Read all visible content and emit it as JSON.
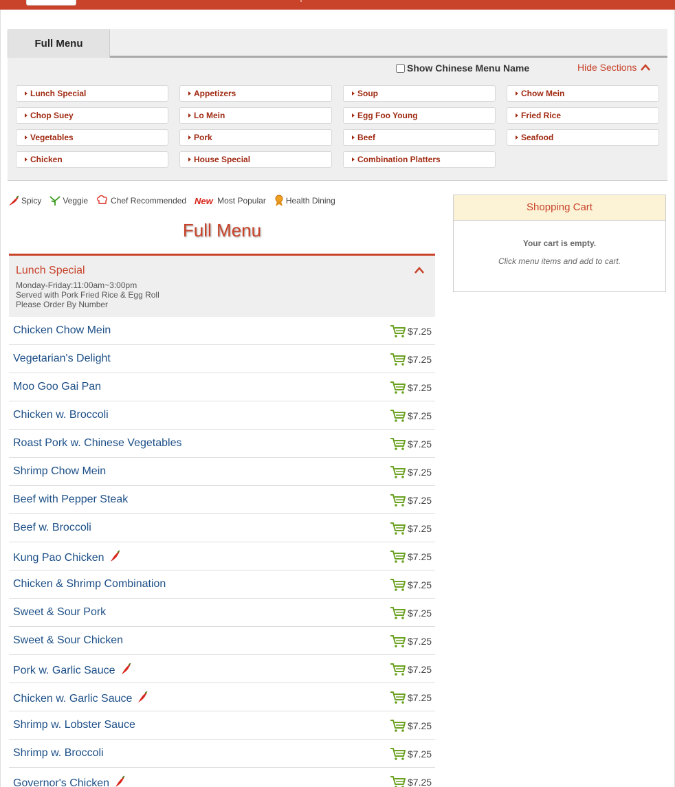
{
  "tabs": [
    {
      "label": "Full Menu",
      "active": true
    }
  ],
  "chinese_toggle": {
    "label": "Show Chinese Menu Name",
    "checked": false
  },
  "hide_sections_label": "Hide Sections",
  "sections": [
    "Lunch Special",
    "Appetizers",
    "Soup",
    "Chow Mein",
    "Chop Suey",
    "Lo Mein",
    "Egg Foo Young",
    "Fried Rice",
    "Vegetables",
    "Pork",
    "Beef",
    "Seafood",
    "Chicken",
    "House Special",
    "Combination Platters"
  ],
  "legend": {
    "spicy": "Spicy",
    "veggie": "Veggie",
    "chef": "Chef Recommended",
    "popular": "Most Popular",
    "new_badge": "New",
    "health": "Health Dining"
  },
  "menu_title": "Full Menu",
  "section": {
    "title": "Lunch Special",
    "desc1": "Monday-Friday:11:00am~3:00pm",
    "desc2": "Served with Pork Fried Rice & Egg Roll",
    "desc3": "Please Order By Number"
  },
  "items": [
    {
      "name": "Chicken Chow Mein",
      "price": "$7.25",
      "spicy": false
    },
    {
      "name": "Vegetarian's Delight",
      "price": "$7.25",
      "spicy": false
    },
    {
      "name": "Moo Goo Gai Pan",
      "price": "$7.25",
      "spicy": false
    },
    {
      "name": "Chicken w. Broccoli",
      "price": "$7.25",
      "spicy": false
    },
    {
      "name": "Roast Pork w. Chinese Vegetables",
      "price": "$7.25",
      "spicy": false
    },
    {
      "name": "Shrimp Chow Mein",
      "price": "$7.25",
      "spicy": false
    },
    {
      "name": "Beef with Pepper Steak",
      "price": "$7.25",
      "spicy": false
    },
    {
      "name": "Beef w. Broccoli",
      "price": "$7.25",
      "spicy": false
    },
    {
      "name": "Kung Pao Chicken",
      "price": "$7.25",
      "spicy": true
    },
    {
      "name": "Chicken & Shrimp Combination",
      "price": "$7.25",
      "spicy": false
    },
    {
      "name": "Sweet & Sour Pork",
      "price": "$7.25",
      "spicy": false
    },
    {
      "name": "Sweet & Sour Chicken",
      "price": "$7.25",
      "spicy": false
    },
    {
      "name": "Pork w. Garlic Sauce",
      "price": "$7.25",
      "spicy": true
    },
    {
      "name": "Chicken w. Garlic Sauce",
      "price": "$7.25",
      "spicy": true
    },
    {
      "name": "Shrimp w. Lobster Sauce",
      "price": "$7.25",
      "spicy": false
    },
    {
      "name": "Shrimp w. Broccoli",
      "price": "$7.25",
      "spicy": false
    },
    {
      "name": "Governor's Chicken",
      "price": "$7.25",
      "spicy": true
    }
  ],
  "cart": {
    "title": "Shopping Cart",
    "empty": "Your cart is empty.",
    "hint": "Click menu items and add to cart."
  },
  "colors": {
    "accent": "#c8432a",
    "link": "#1c4f87",
    "cart_green": "#6aa121"
  }
}
